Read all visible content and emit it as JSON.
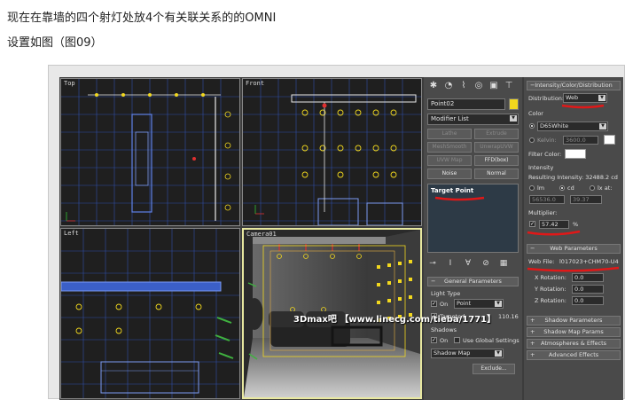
{
  "intro": {
    "line1": "现在在靠墙的四个射灯处放4个有关联关系的的OMNI",
    "line2": "设置如图（图09）"
  },
  "viewports": {
    "top": "Top",
    "front": "Front",
    "left": "Left",
    "camera": "Camera01"
  },
  "command_panel": {
    "object_name": "Point02",
    "object_color": "#f2d81e",
    "modifier_list": "Modifier List",
    "buttons": [
      "Lathe",
      "Extrude",
      "MeshSmooth",
      "UnwrapUVW",
      "UVW Map",
      "FFD(box)",
      "Noise",
      "Normal"
    ],
    "stack_item": "Target Point",
    "general_params": {
      "title": "General Parameters",
      "light_type": "Light Type",
      "on": "On",
      "type_value": "Point",
      "targeted": "Targeted",
      "targeted_value": "110.16",
      "shadows": "Shadows",
      "shadows_on": "On",
      "use_global": "Use Global Settings",
      "shadow_type": "Shadow Map",
      "exclude": "Exclude..."
    }
  },
  "params_panel": {
    "icd_title": "Intensity/Color/Distribution",
    "distribution_label": "Distribution:",
    "distribution_value": "Web",
    "color_label": "Color",
    "color_preset": "D65White",
    "kelvin_label": "Kelvin:",
    "kelvin_value": "3600.0",
    "filter_color": "Filter Color:",
    "intensity_label": "Intensity",
    "resulting": "Resulting Intensity: 32488.2 cd",
    "lm": "lm",
    "cd": "cd",
    "lx_at": "lx at:",
    "lm_value": "56536.0",
    "cd_value": "39.37",
    "multiplier_label": "Multiplier:",
    "multiplier_value": "57.42",
    "percent": "%",
    "web_params_title": "Web Parameters",
    "web_file_label": "Web File:",
    "web_file_value": "l017023+CHM70-U4",
    "x_rotation": "X Rotation:",
    "y_rotation": "Y Rotation:",
    "z_rotation": "Z Rotation:",
    "rot_value": "0.0",
    "sections": [
      "Shadow Parameters",
      "Shadow Map Params",
      "Atmospheres & Effects",
      "Advanced Effects"
    ]
  },
  "watermark": "3Dmax吧 【www.linecg.com/tieba/1771】"
}
